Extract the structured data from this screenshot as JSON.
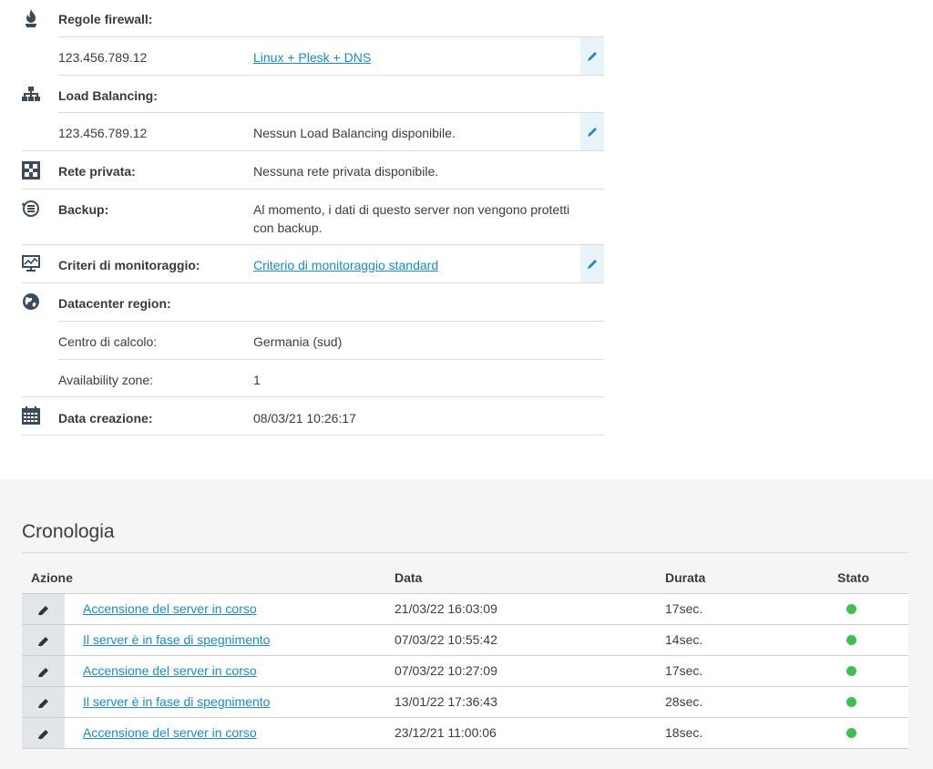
{
  "details": {
    "firewall": {
      "label": "Regole firewall:",
      "ip": "123.456.789.12",
      "value": "Linux + Plesk + DNS"
    },
    "load_balancing": {
      "label": "Load Balancing:",
      "ip": "123.456.789.12",
      "value": "Nessun Load Balancing disponibile."
    },
    "private_network": {
      "label": "Rete privata:",
      "value": "Nessuna rete privata disponibile."
    },
    "backup": {
      "label": "Backup:",
      "value_line1": "Al momento, i dati di questo server non vengono protetti",
      "value_line2": "con backup."
    },
    "monitoring": {
      "label": "Criteri di monitoraggio:",
      "value": "Criterio di monitoraggio standard"
    },
    "datacenter": {
      "label": "Datacenter region:",
      "center_label": "Centro di calcolo:",
      "center_value": "Germania (sud)",
      "zone_label": "Availability zone:",
      "zone_value": "1"
    },
    "created": {
      "label": "Data creazione:",
      "value": "08/03/21 10:26:17"
    }
  },
  "history": {
    "title": "Cronologia",
    "columns": {
      "action": "Azione",
      "date": "Data",
      "duration": "Durata",
      "status": "Stato"
    },
    "rows": [
      {
        "action": "Accensione del server in corso",
        "date": "21/03/22 16:03:09",
        "duration": "17sec."
      },
      {
        "action": "Il server è in fase di spegnimento",
        "date": "07/03/22 10:55:42",
        "duration": "14sec."
      },
      {
        "action": "Accensione del server in corso",
        "date": "07/03/22 10:27:09",
        "duration": "17sec."
      },
      {
        "action": "Il server è in fase di spegnimento",
        "date": "13/01/22 17:36:43",
        "duration": "28sec."
      },
      {
        "action": "Accensione del server in corso",
        "date": "23/12/21 11:00:06",
        "duration": "18sec."
      }
    ]
  },
  "colors": {
    "link": "#1a8cc7",
    "status_ok": "#3cc14e",
    "edit_bg": "#e8f4fa"
  },
  "icons": [
    "flame-icon",
    "network-tree-icon",
    "private-network-icon",
    "backup-icon",
    "monitor-icon",
    "globe-icon",
    "calendar-icon",
    "pencil-icon",
    "status-dot-icon"
  ]
}
